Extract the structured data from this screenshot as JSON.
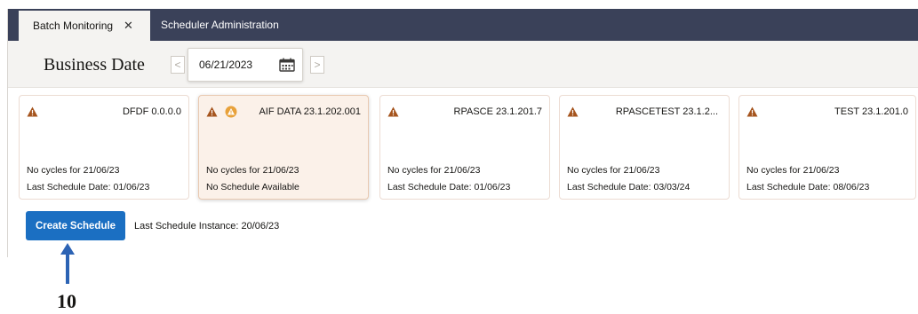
{
  "tabs": {
    "active_label": "Batch Monitoring",
    "close_glyph": "✕",
    "inactive_label": "Scheduler Administration"
  },
  "business_date": {
    "title": "Business Date",
    "prev_glyph": "<",
    "next_glyph": ">",
    "value": "06/21/2023",
    "calendar_icon": "calendar-icon"
  },
  "cards": [
    {
      "name": "DFDF 0.0.0.0",
      "line1": "No cycles for 21/06/23",
      "line2": "Last Schedule Date: 01/06/23",
      "icons": [
        "warning-icon"
      ]
    },
    {
      "name": "AIF DATA 23.1.202.001",
      "line1": "No cycles for 21/06/23",
      "line2": "No Schedule Available",
      "icons": [
        "warning-icon",
        "alert-circle-icon"
      ],
      "selected": true
    },
    {
      "name": "RPASCE 23.1.201.7",
      "line1": "No cycles for 21/06/23",
      "line2": "Last Schedule Date: 01/06/23",
      "icons": [
        "warning-icon"
      ]
    },
    {
      "name": "RPASCETEST 23.1.2...",
      "line1": "No cycles for 21/06/23",
      "line2": "Last Schedule Date: 03/03/24",
      "icons": [
        "warning-icon"
      ]
    },
    {
      "name": "TEST 23.1.201.0",
      "line1": "No cycles for 21/06/23",
      "line2": "Last Schedule Date: 08/06/23",
      "icons": [
        "warning-icon"
      ]
    }
  ],
  "actions": {
    "create_label": "Create Schedule",
    "last_instance": "Last Schedule Instance: 20/06/23"
  },
  "annotation": {
    "callout_number": "10"
  },
  "colors": {
    "tab_bar": "#3a4159",
    "primary_button": "#1b6fc2",
    "warning": "#a5541d",
    "alert_circle": "#e8a13a",
    "arrow": "#2c63b4"
  }
}
